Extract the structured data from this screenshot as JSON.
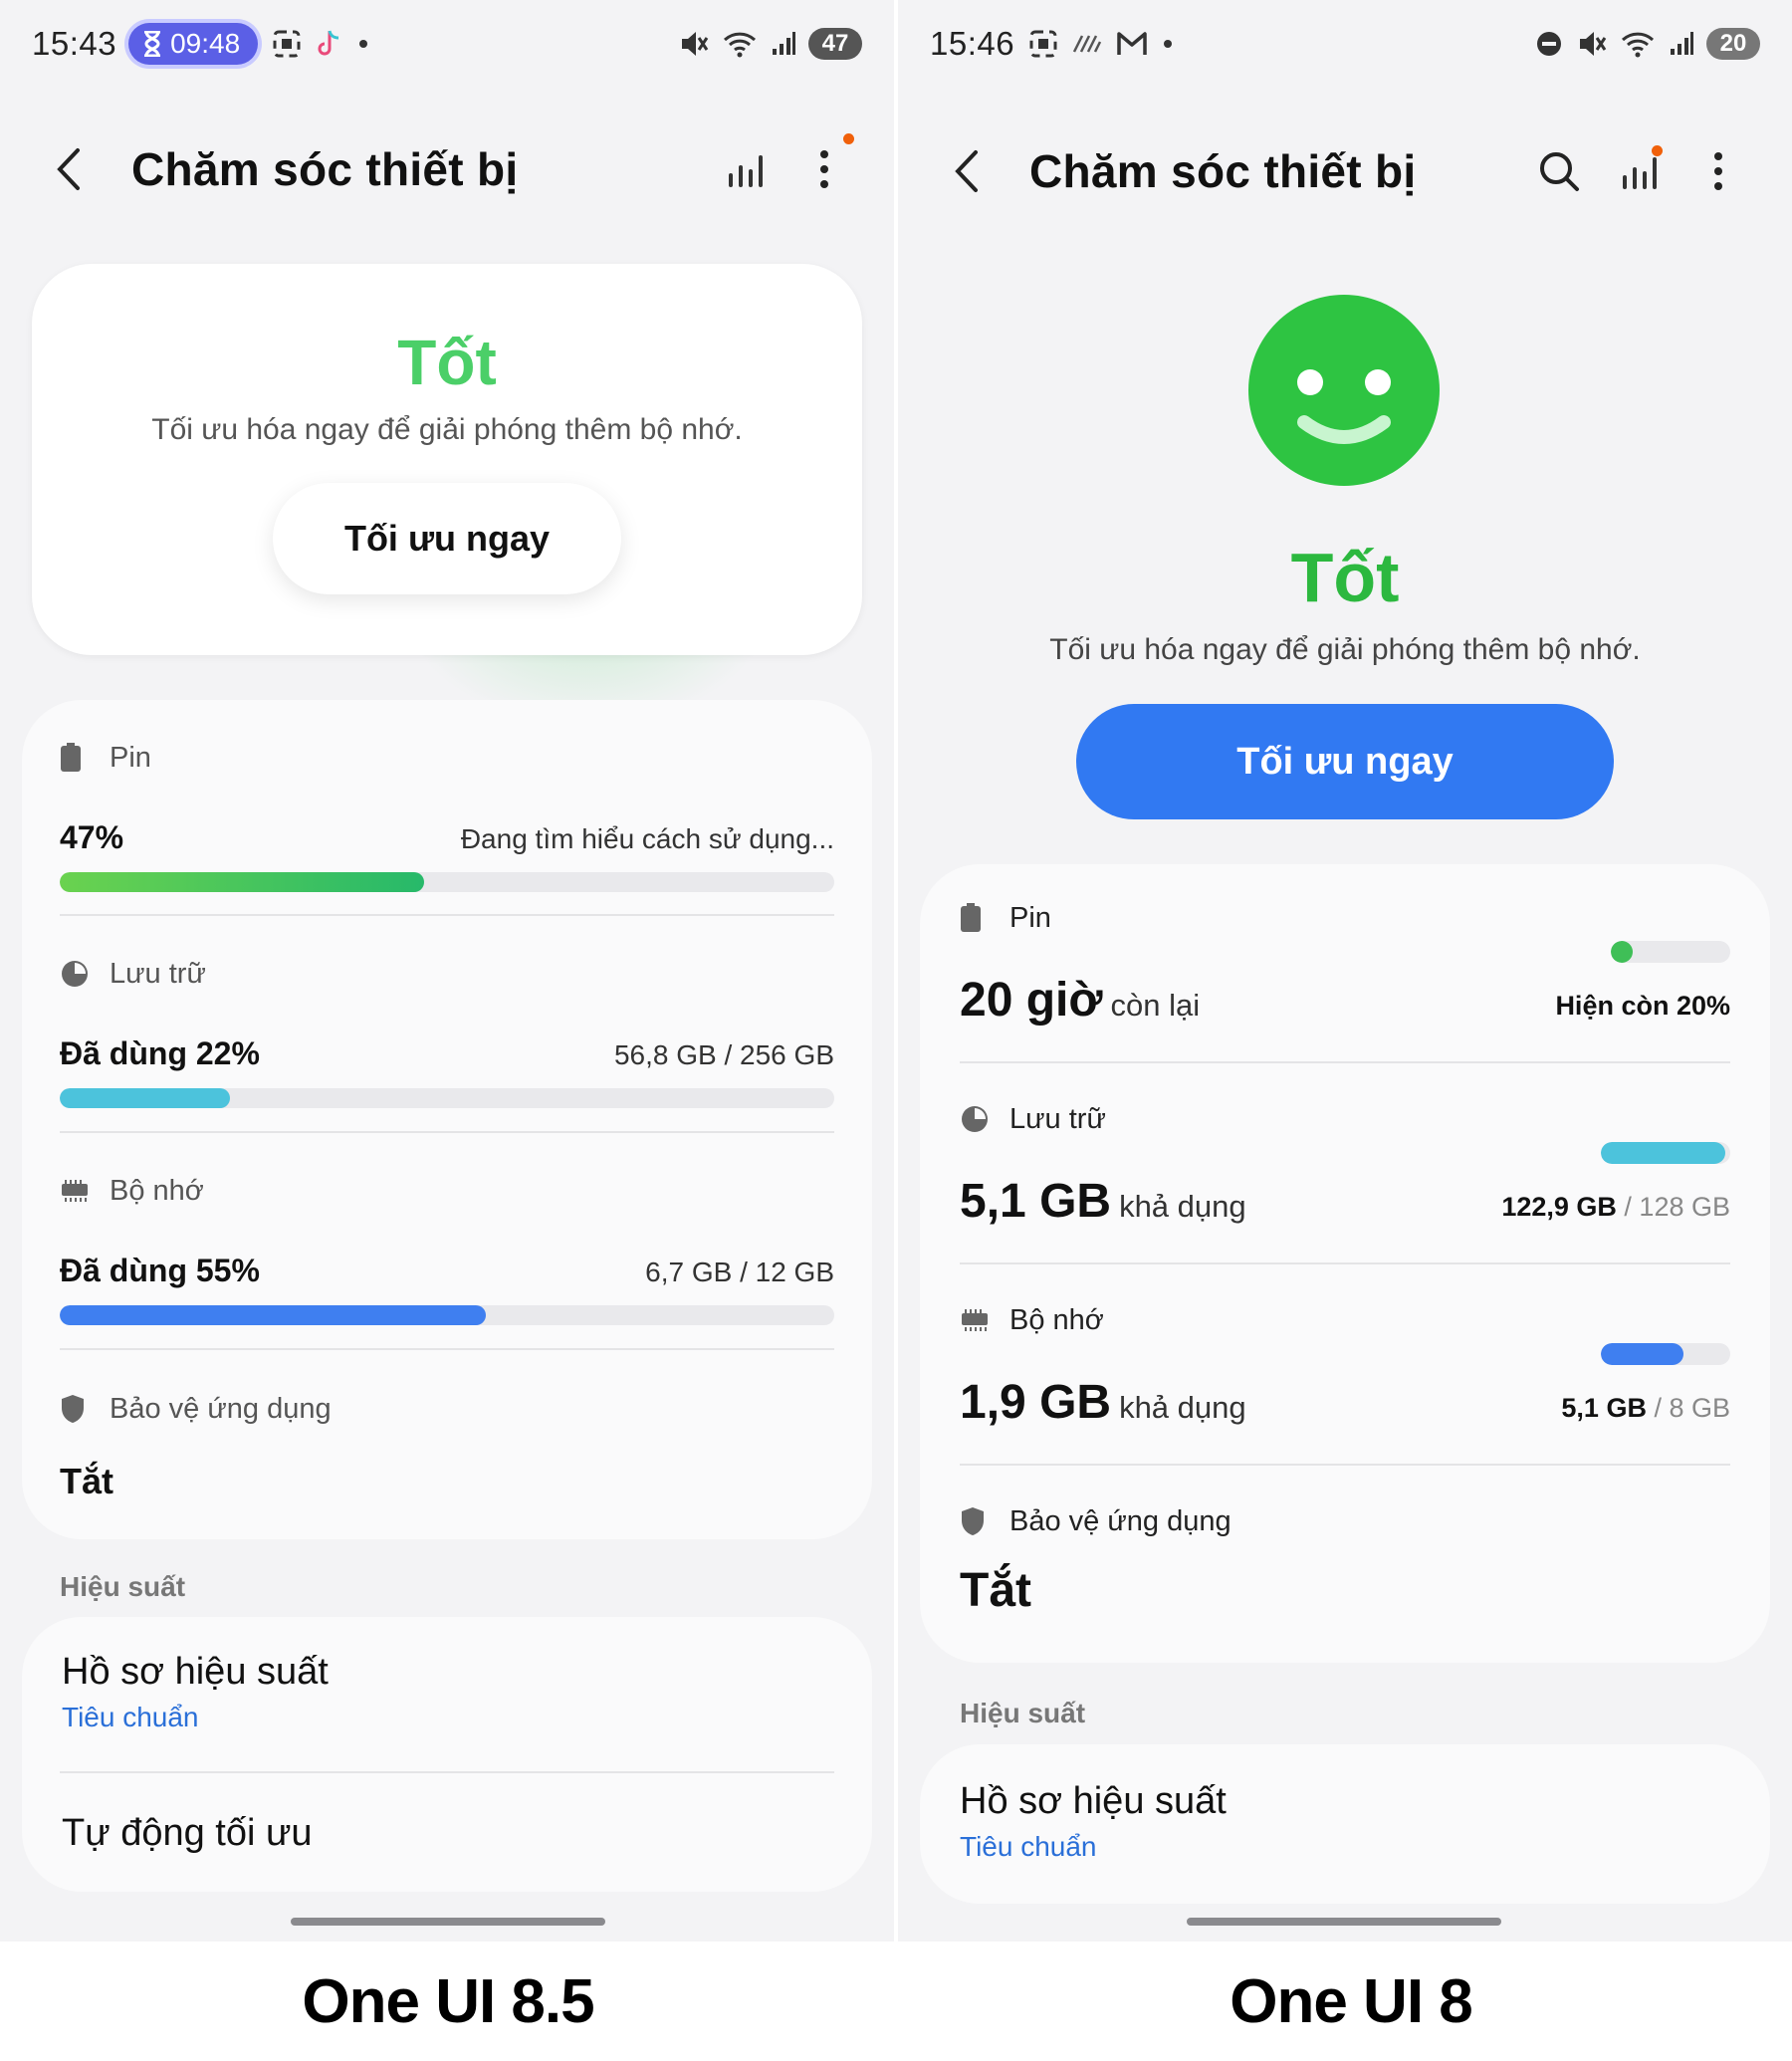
{
  "left": {
    "status_bar": {
      "time": "15:43",
      "timer": "09:48",
      "battery": "47"
    },
    "app_bar": {
      "title": "Chăm sóc thiết bị"
    },
    "hero": {
      "status": "Tốt",
      "description": "Tối ưu hóa ngay để giải phóng thêm bộ nhớ.",
      "button": "Tối ưu ngay"
    },
    "battery": {
      "label": "Pin",
      "value": "47%",
      "detail": "Đang tìm hiểu cách sử dụng...",
      "level": 0.47
    },
    "storage": {
      "label": "Lưu trữ",
      "value": "Đã dùng 22%",
      "detail": "56,8 GB / 256 GB",
      "level": 0.22
    },
    "memory": {
      "label": "Bộ nhớ",
      "value": "Đã dùng 55%",
      "detail": "6,7 GB / 12 GB",
      "level": 0.55
    },
    "app_protection": {
      "label": "Bảo vệ ứng dụng",
      "value": "Tắt"
    },
    "performance": {
      "group_label": "Hiệu suất",
      "profile_title": "Hồ sơ hiệu suất",
      "profile_value": "Tiêu chuẩn",
      "auto_optimize": "Tự động tối ưu"
    },
    "caption": "One UI 8.5"
  },
  "right": {
    "status_bar": {
      "time": "15:46",
      "battery": "20"
    },
    "app_bar": {
      "title": "Chăm sóc thiết bị"
    },
    "hero": {
      "status": "Tốt",
      "description": "Tối ưu hóa ngay để giải phóng thêm bộ nhớ.",
      "button": "Tối ưu ngay"
    },
    "battery": {
      "label": "Pin",
      "value": "20 giờ",
      "unit": "còn lại",
      "detail": "Hiện còn 20%",
      "level": 0.2
    },
    "storage": {
      "label": "Lưu trữ",
      "value": "5,1 GB",
      "unit": "khả dụng",
      "used": "122,9 GB",
      "total": "/ 128 GB",
      "level": 0.96
    },
    "memory": {
      "label": "Bộ nhớ",
      "value": "1,9 GB",
      "unit": "khả dụng",
      "used": "5,1 GB",
      "total": "/ 8 GB",
      "level": 0.64
    },
    "app_protection": {
      "label": "Bảo vệ ứng dụng",
      "value": "Tắt"
    },
    "performance": {
      "group_label": "Hiệu suất",
      "profile_title": "Hồ sơ hiệu suất",
      "profile_value": "Tiêu chuẩn"
    },
    "caption": "One UI 8"
  },
  "colors": {
    "battery_fill": "#3fbf57",
    "storage_fill": "#4cc3dc",
    "memory_fill": "#3f7ff0",
    "good_green": "#4bcf68",
    "primary_blue": "#3179f2"
  }
}
